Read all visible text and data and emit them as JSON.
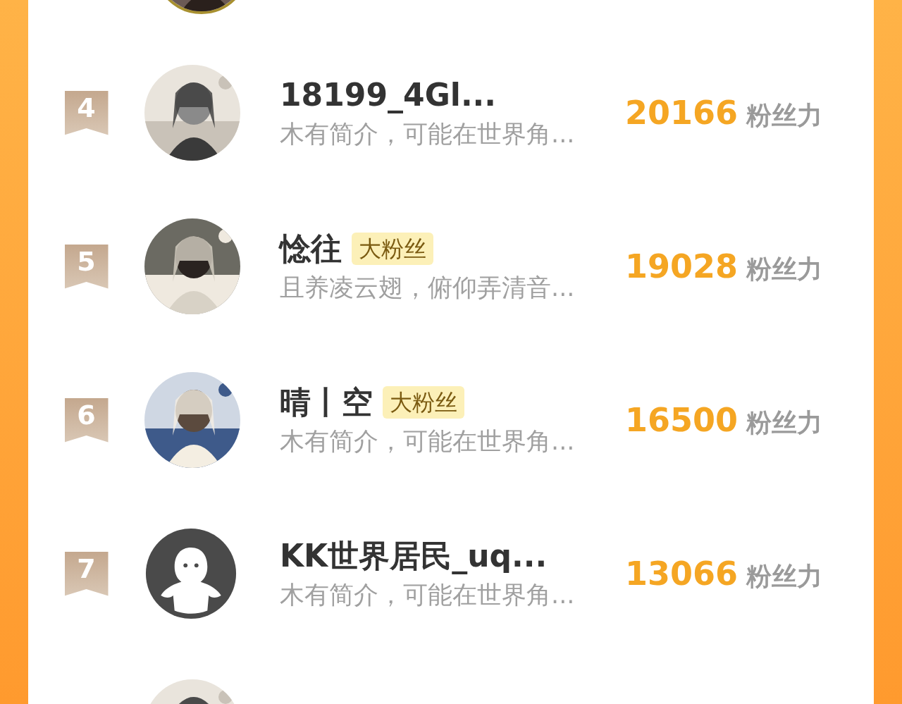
{
  "top_partial": {
    "kind": "picture"
  },
  "rows": [
    {
      "rank": "4",
      "avatar": {
        "kind": "picture"
      },
      "name": "18199_4Gl...",
      "badge": null,
      "bio": "木有简介，可能在世界角...",
      "score": "20166",
      "score_unit": "粉丝力"
    },
    {
      "rank": "5",
      "avatar": {
        "kind": "picture"
      },
      "name": "惗往",
      "badge": "大粉丝",
      "bio": "且养凌云翅，俯仰弄清音...",
      "score": "19028",
      "score_unit": "粉丝力"
    },
    {
      "rank": "6",
      "avatar": {
        "kind": "picture"
      },
      "name": "晴丨空",
      "badge": "大粉丝",
      "bio": "木有简介，可能在世界角...",
      "score": "16500",
      "score_unit": "粉丝力"
    },
    {
      "rank": "7",
      "avatar": {
        "kind": "default"
      },
      "name": "KK世界居民_uq...",
      "badge": null,
      "bio": "木有简介，可能在世界角...",
      "score": "13066",
      "score_unit": "粉丝力"
    },
    {
      "avatar": {
        "kind": "picture"
      }
    }
  ]
}
